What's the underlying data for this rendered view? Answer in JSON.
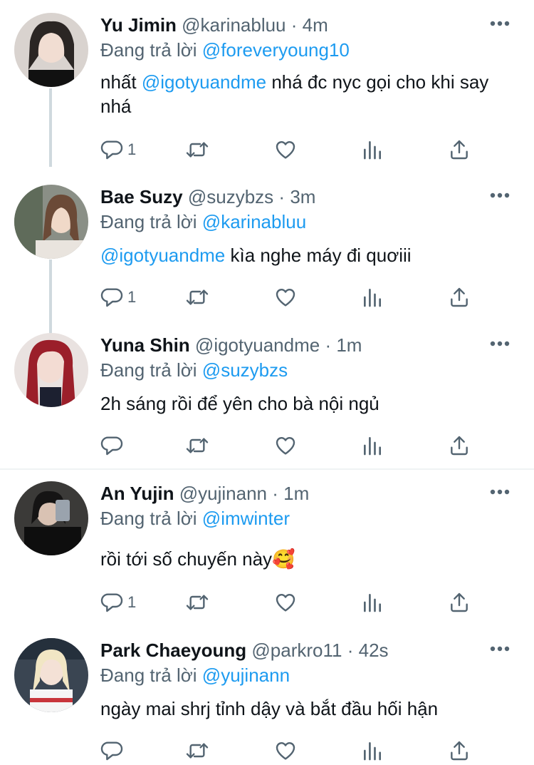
{
  "icons": {
    "more": "more-horizontal-icon",
    "reply": "reply-bubble-icon",
    "retweet": "retweet-icon",
    "like": "heart-icon",
    "views": "bar-chart-icon",
    "share": "share-upload-icon"
  },
  "colors": {
    "mention": "#1d9bf0",
    "muted": "#536471",
    "text": "#0f1419"
  },
  "replying_prefix": "Đang trả lời",
  "tweets": [
    {
      "name": "Yu Jimin",
      "handle": "@karinabluu",
      "dot": "·",
      "time": "4m",
      "reply_to": "@foreveryoung10",
      "body_mention": "@igotyuandme",
      "body_before": "nhất ",
      "body_after": " nhá đc nyc gọi cho khi say nhá",
      "reply_count": "1"
    },
    {
      "name": "Bae Suzy",
      "handle": "@suzybzs",
      "dot": "·",
      "time": "3m",
      "reply_to": "@karinabluu",
      "body_mention": "@igotyuandme",
      "body_before": "",
      "body_after": " kìa nghe máy đi quơiii",
      "reply_count": "1"
    },
    {
      "name": "Yuna Shin",
      "handle": "@igotyuandme",
      "dot": "·",
      "time": "1m",
      "reply_to": "@suzybzs",
      "body_mention": "",
      "body_before": "2h sáng rồi để yên cho bà nội ngủ",
      "body_after": "",
      "reply_count": ""
    },
    {
      "name": "An Yujin",
      "handle": "@yujinann",
      "dot": "·",
      "time": "1m",
      "reply_to": "@imwinter",
      "body_mention": "",
      "body_before": "rồi tới số chuyến này🥰",
      "body_after": "",
      "reply_count": "1"
    },
    {
      "name": "Park Chaeyoung",
      "handle": "@parkro11",
      "dot": "·",
      "time": "42s",
      "reply_to": "@yujinann",
      "body_mention": "",
      "body_before": "ngày mai shrj tỉnh dậy và bắt đầu hối hận",
      "body_after": "",
      "reply_count": ""
    }
  ]
}
